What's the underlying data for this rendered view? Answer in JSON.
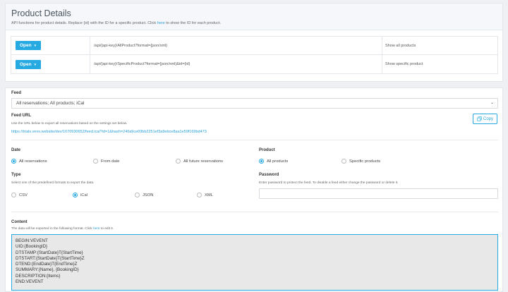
{
  "header": {
    "title": "Product Details",
    "subtitle_before": "API functions for product details. Replace {id} with the ID for a specific product. Click ",
    "subtitle_link": "here",
    "subtitle_after": " to show the ID for each product."
  },
  "api_rows": [
    {
      "button": "Open",
      "url": "/api/{api-key}/AllProduct?format={json/xml}",
      "description": "Show all products"
    },
    {
      "button": "Open",
      "url": "/api/{api-key}/SpecificProduct?format={json/xml}&id={id}",
      "description": "Show specific product"
    }
  ],
  "feed": {
    "label": "Feed",
    "selected": "All reservations; All products; iCal",
    "url_label": "Feed URL",
    "url_help": "Use the URL below to export all reservations based on the settings set below.",
    "url": "https://trials.vevs.website/dev/1670930652/feed.ical?id=1&hash=240a9ce09bb2251ef3a9ebce8aa1e59f169bd473",
    "copy_label": "Copy"
  },
  "date": {
    "label": "Date",
    "options": [
      "All reservations",
      "From date",
      "All future reservations"
    ],
    "selected": 0
  },
  "product": {
    "label": "Product",
    "options": [
      "All products",
      "Specific products"
    ],
    "selected": 0
  },
  "type": {
    "label": "Type",
    "help": "Select one of the predefined formats to export the data.",
    "options": [
      "CSV",
      "iCal",
      "JSON",
      "XML"
    ],
    "selected": 1
  },
  "password": {
    "label": "Password",
    "help": "Enter password to protect the feed. To disable a feed either change the password or delete it.",
    "value": ""
  },
  "content": {
    "label": "Content",
    "help_before": "The data will be exported in the following format. Click ",
    "help_link": "here",
    "help_after": " to edit it.",
    "lines": [
      "BEGIN:VEVENT",
      "UID:{BookingID}",
      "DTSTAMP:{StartDate}T{StartTime}",
      "DTSTART:{StartDate}T{StartTime}Z",
      "DTEND:{EndDate}T{EndTime}Z",
      "SUMMARY:{Name}, {BookingID}",
      "DESCRIPTION:{Items}",
      "END:VEVENT"
    ]
  },
  "colors": {
    "accent": "#27a9e1",
    "link": "#2ba0d8",
    "background": "#eef0f3"
  }
}
